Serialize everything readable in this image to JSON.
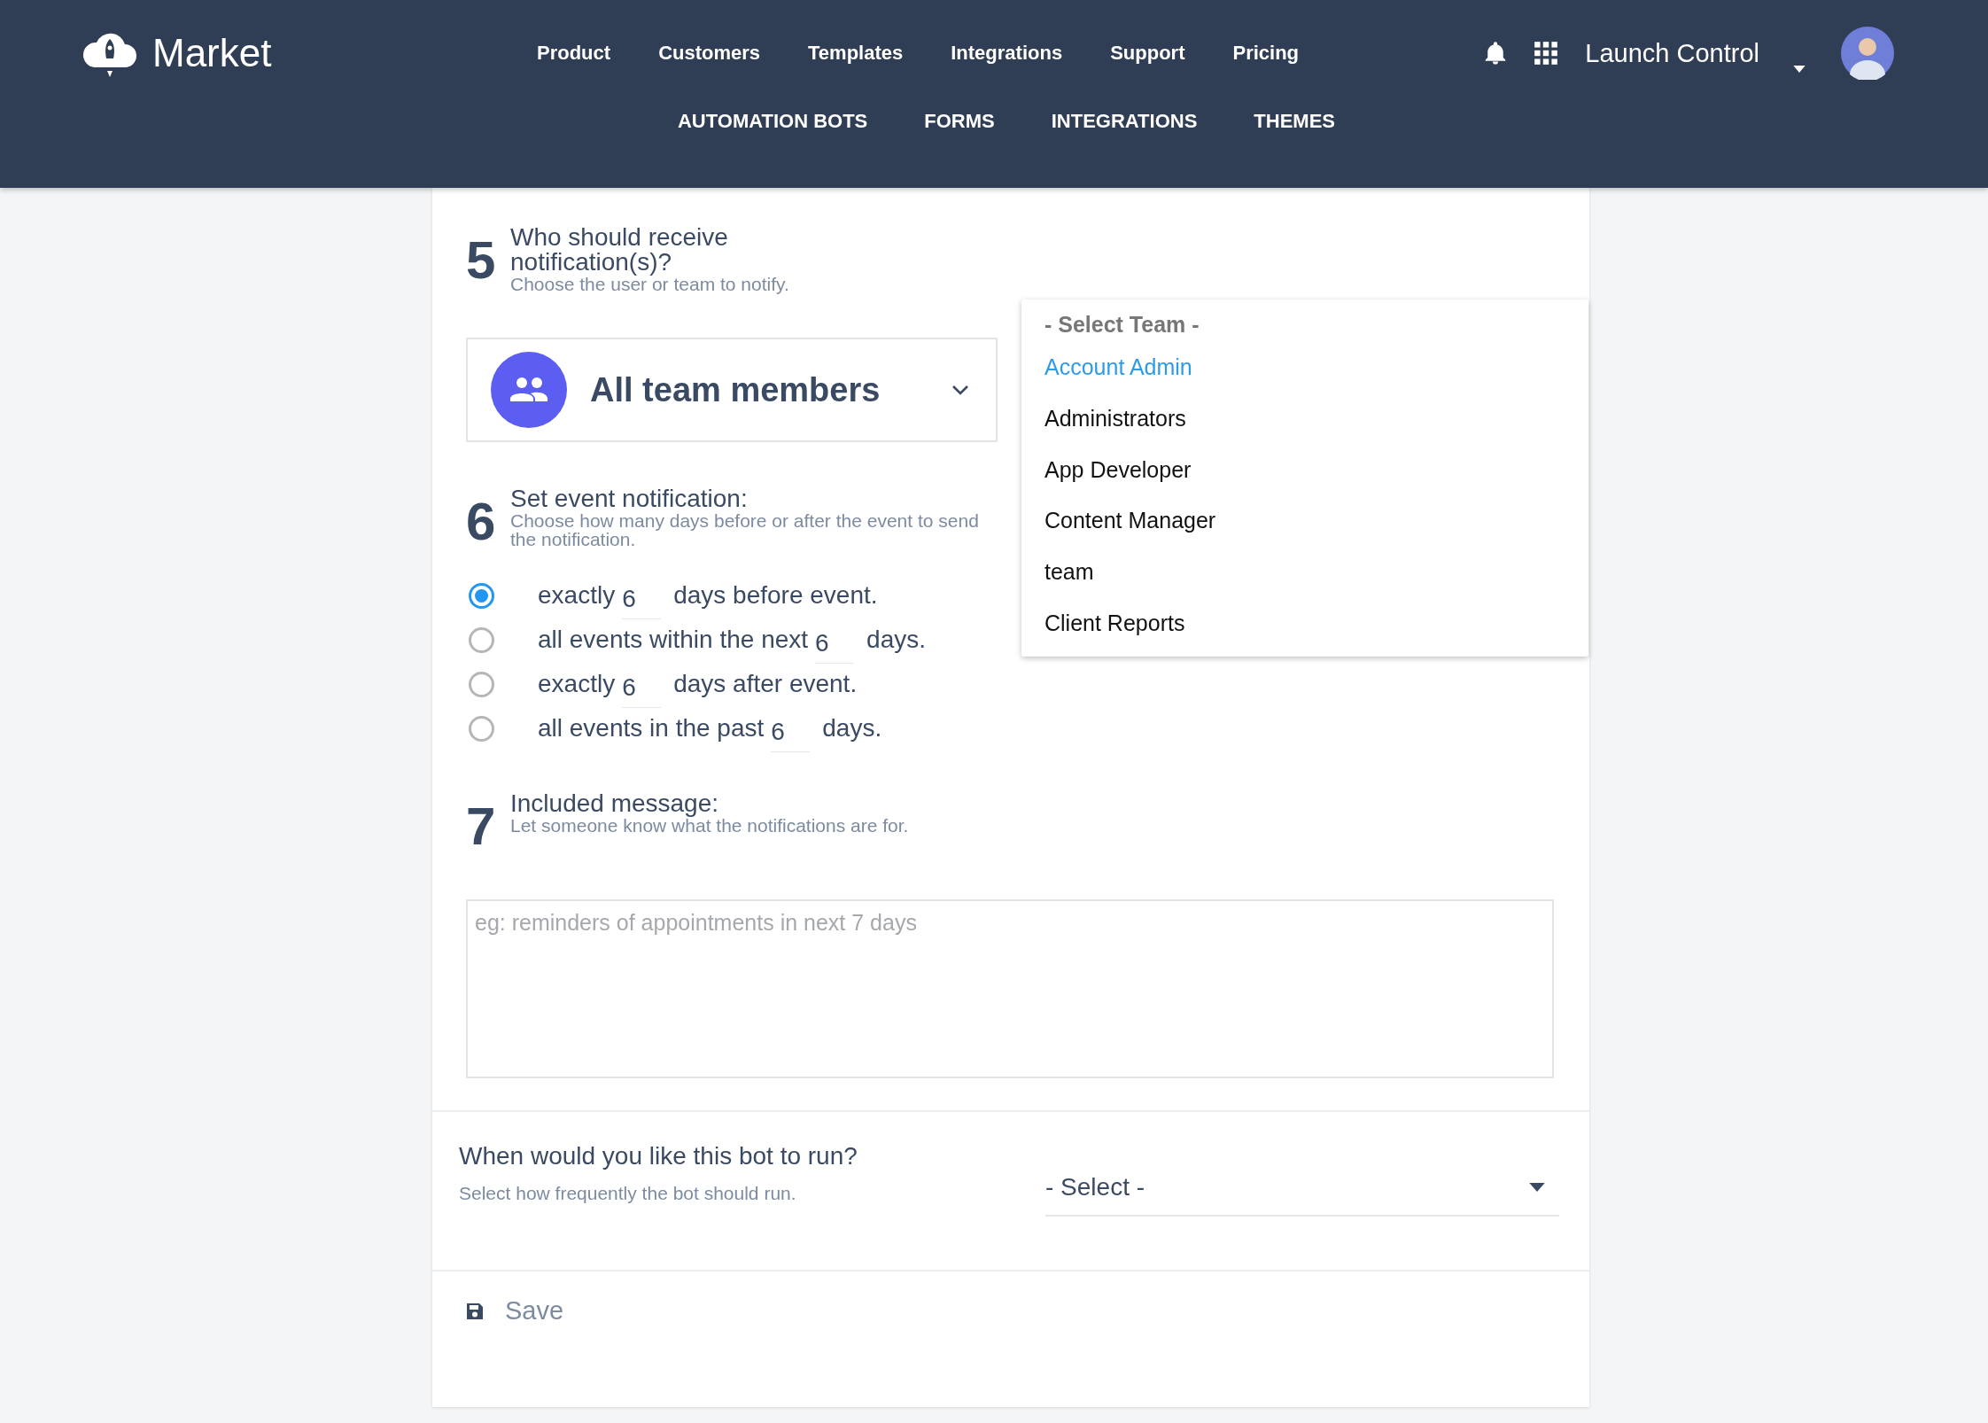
{
  "brand": {
    "name": "Market"
  },
  "nav": [
    "Product",
    "Customers",
    "Templates",
    "Integrations",
    "Support",
    "Pricing"
  ],
  "account": {
    "name": "Launch Control"
  },
  "subnav": [
    "AUTOMATION BOTS",
    "FORMS",
    "INTEGRATIONS",
    "THEMES"
  ],
  "steps": [
    {
      "number": "5",
      "title": "Who should receive notification(s)?",
      "subtitle": "Choose the user or team to notify.",
      "kind": "recipient",
      "recipient": {
        "value": "All team members"
      }
    },
    {
      "number": "6",
      "title": "Set event notification:",
      "subtitle": "Choose how many days before or after the event to send the notification.",
      "kind": "options",
      "options": [
        {
          "before": "exactly",
          "value": "6",
          "after": "days before event.",
          "selected": true
        },
        {
          "before": "all events within the next",
          "value": "6",
          "after": "days.",
          "selected": false
        },
        {
          "before": "exactly",
          "value": "6",
          "after": "days after event.",
          "selected": false
        },
        {
          "before": "all events in the past",
          "value": "6",
          "after": "days.",
          "selected": false
        }
      ]
    },
    {
      "number": "7",
      "title": "Included message:",
      "subtitle": "Let someone know what the notifications are for.",
      "kind": "message",
      "message": {
        "placeholder": "eg: reminders of appointments in next 7 days"
      }
    }
  ],
  "schedule": {
    "title": "When would you like this bot to run?",
    "subtitle": "Select how frequently the bot should run.",
    "select": {
      "value": "- Select -"
    }
  },
  "save": {
    "label": "Save"
  },
  "team_menu": {
    "items": [
      {
        "label": "- Select Team -",
        "kind": "placeholder",
        "selected": false
      },
      {
        "label": "Account Admin",
        "kind": "option",
        "selected": true
      },
      {
        "label": "Administrators",
        "kind": "option",
        "selected": false
      },
      {
        "label": "App Developer",
        "kind": "option",
        "selected": false
      },
      {
        "label": "Content Manager",
        "kind": "option",
        "selected": false
      },
      {
        "label": "team",
        "kind": "option",
        "selected": false
      },
      {
        "label": "Client Reports",
        "kind": "option",
        "selected": false
      }
    ]
  }
}
